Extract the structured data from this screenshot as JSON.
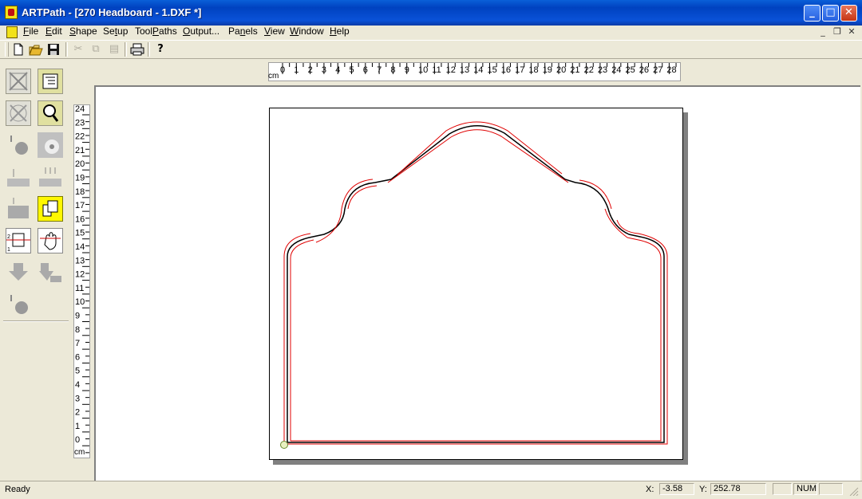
{
  "window": {
    "app_name": "ARTPath",
    "document": "[270 Headboard - 1.DXF *]"
  },
  "title_bar": {
    "title": "ARTPath - [270 Headboard - 1.DXF *]"
  },
  "menu": {
    "items": [
      {
        "label": "File",
        "u": "F",
        "rest": "ile"
      },
      {
        "label": "Edit",
        "u": "E",
        "rest": "dit"
      },
      {
        "label": "Shape",
        "u": "S",
        "rest": "hape"
      },
      {
        "label": "Setup",
        "pre": "Se",
        "u": "t",
        "rest": "up"
      },
      {
        "label": "ToolPaths",
        "pre": "Tool",
        "u": "P",
        "rest": "aths"
      },
      {
        "label": "Output...",
        "u": "O",
        "rest": "utput..."
      },
      {
        "label": "Panels",
        "pre": "Pa",
        "u": "n",
        "rest": "els"
      },
      {
        "label": "View",
        "u": "V",
        "rest": "iew"
      },
      {
        "label": "Window",
        "u": "W",
        "rest": "indow"
      },
      {
        "label": "Help",
        "u": "H",
        "rest": "elp"
      }
    ]
  },
  "toolbar": {
    "buttons": [
      "new-icon",
      "open-icon",
      "save-icon",
      "cut-icon",
      "copy-icon",
      "paste-icon",
      "print-icon",
      "help-icon"
    ]
  },
  "rulers": {
    "unit": "cm",
    "horizontal": [
      "0",
      "1",
      "2",
      "3",
      "4",
      "5",
      "6",
      "7",
      "8",
      "9",
      "10",
      "11",
      "12",
      "13",
      "14",
      "15",
      "16",
      "17",
      "18",
      "19",
      "20",
      "21",
      "22",
      "23",
      "24",
      "25",
      "26",
      "27",
      "28"
    ],
    "vertical": [
      "24",
      "23",
      "22",
      "21",
      "20",
      "19",
      "18",
      "17",
      "16",
      "15",
      "14",
      "13",
      "12",
      "11",
      "10",
      "9",
      "8",
      "7",
      "6",
      "5",
      "4",
      "3",
      "2",
      "1",
      "0"
    ]
  },
  "status": {
    "ready": "Ready",
    "x_label": "X:",
    "x_value": "-3.58",
    "y_label": "Y:",
    "y_value": "252.78",
    "num": "NUM"
  },
  "colors": {
    "titlebar": "#0a52d8",
    "toolpath": "#e00000",
    "shape": "#000000"
  }
}
